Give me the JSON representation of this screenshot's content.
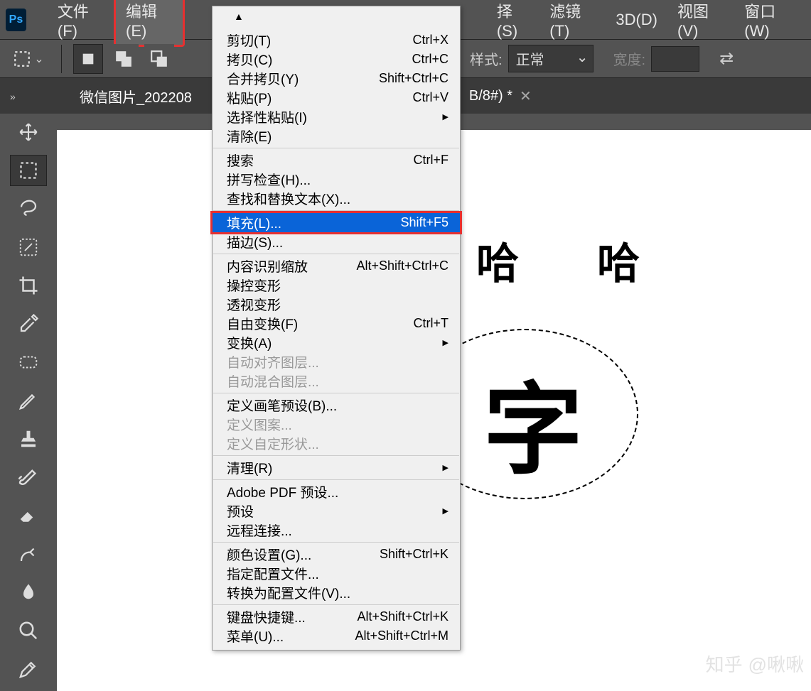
{
  "menubar": {
    "items": [
      {
        "label": "文件(F)"
      },
      {
        "label": "编辑(E)"
      },
      {
        "label": "择(S)"
      },
      {
        "label": "滤镜(T)"
      },
      {
        "label": "3D(D)"
      },
      {
        "label": "视图(V)"
      },
      {
        "label": "窗口(W)"
      }
    ],
    "highlightedIndex": 1
  },
  "optionsbar": {
    "styleLabel": "样式:",
    "styleValue": "正常",
    "widthLabel": "宽度:"
  },
  "tab": {
    "title_left": "微信图片_202208",
    "title_right": "B/8#) *"
  },
  "dropdown": {
    "groups": [
      [
        {
          "label": "剪切(T)",
          "shortcut": "Ctrl+X"
        },
        {
          "label": "拷贝(C)",
          "shortcut": "Ctrl+C"
        },
        {
          "label": "合并拷贝(Y)",
          "shortcut": "Shift+Ctrl+C"
        },
        {
          "label": "粘贴(P)",
          "shortcut": "Ctrl+V"
        },
        {
          "label": "选择性粘贴(I)",
          "shortcut": "",
          "submenu": true
        },
        {
          "label": "清除(E)",
          "shortcut": ""
        }
      ],
      [
        {
          "label": "搜索",
          "shortcut": "Ctrl+F"
        },
        {
          "label": "拼写检查(H)...",
          "shortcut": ""
        },
        {
          "label": "查找和替换文本(X)...",
          "shortcut": ""
        }
      ],
      [
        {
          "label": "填充(L)...",
          "shortcut": "Shift+F5",
          "highlighted": true
        },
        {
          "label": "描边(S)...",
          "shortcut": ""
        }
      ],
      [
        {
          "label": "内容识别缩放",
          "shortcut": "Alt+Shift+Ctrl+C"
        },
        {
          "label": "操控变形",
          "shortcut": ""
        },
        {
          "label": "透视变形",
          "shortcut": ""
        },
        {
          "label": "自由变换(F)",
          "shortcut": "Ctrl+T"
        },
        {
          "label": "变换(A)",
          "shortcut": "",
          "submenu": true
        },
        {
          "label": "自动对齐图层...",
          "shortcut": "",
          "disabled": true
        },
        {
          "label": "自动混合图层...",
          "shortcut": "",
          "disabled": true
        }
      ],
      [
        {
          "label": "定义画笔预设(B)...",
          "shortcut": ""
        },
        {
          "label": "定义图案...",
          "shortcut": "",
          "disabled": true
        },
        {
          "label": "定义自定形状...",
          "shortcut": "",
          "disabled": true
        }
      ],
      [
        {
          "label": "清理(R)",
          "shortcut": "",
          "submenu": true
        }
      ],
      [
        {
          "label": "Adobe PDF 预设...",
          "shortcut": ""
        },
        {
          "label": "预设",
          "shortcut": "",
          "submenu": true
        },
        {
          "label": "远程连接...",
          "shortcut": ""
        }
      ],
      [
        {
          "label": "颜色设置(G)...",
          "shortcut": "Shift+Ctrl+K"
        },
        {
          "label": "指定配置文件...",
          "shortcut": ""
        },
        {
          "label": "转换为配置文件(V)...",
          "shortcut": ""
        }
      ],
      [
        {
          "label": "键盘快捷键...",
          "shortcut": "Alt+Shift+Ctrl+K"
        },
        {
          "label": "菜单(U)...",
          "shortcut": "Alt+Shift+Ctrl+M"
        }
      ]
    ]
  },
  "canvas": {
    "text1": "哈",
    "text2": "哈",
    "bigText": "字"
  },
  "watermark": {
    "site": "知乎",
    "author": "@啾啾"
  }
}
